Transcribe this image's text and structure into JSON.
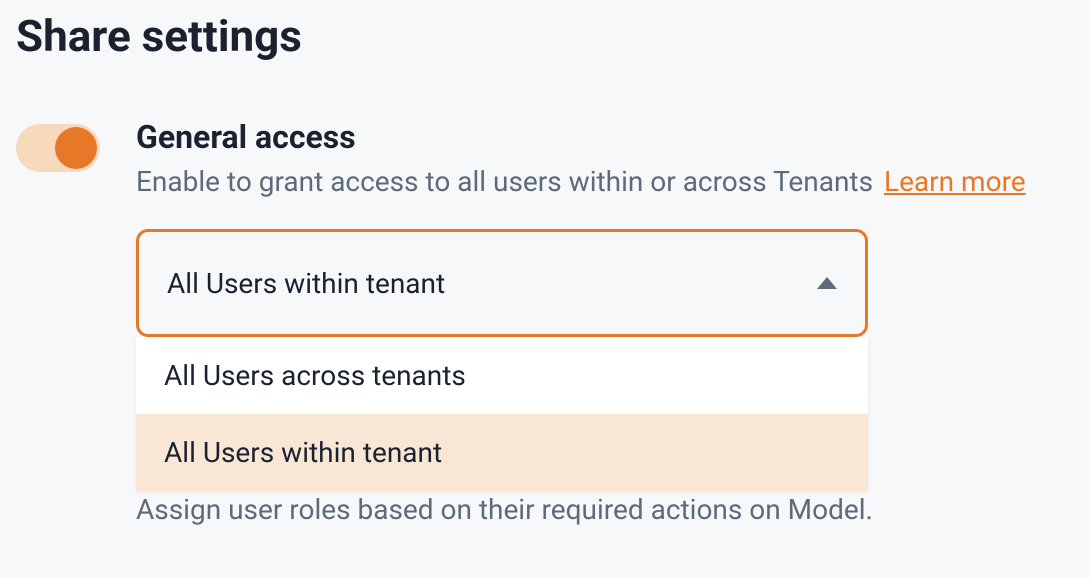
{
  "page_title": "Share settings",
  "general_access": {
    "heading": "General access",
    "description": "Enable to grant access to all users within or across Tenants",
    "learn_more_label": "Learn more",
    "toggle_on": true
  },
  "dropdown": {
    "selected": "All Users within tenant",
    "options": [
      {
        "label": "All Users across tenants",
        "selected": false
      },
      {
        "label": "All Users within tenant",
        "selected": true
      }
    ]
  },
  "helper_text": "Assign user roles based on their required actions on Model."
}
